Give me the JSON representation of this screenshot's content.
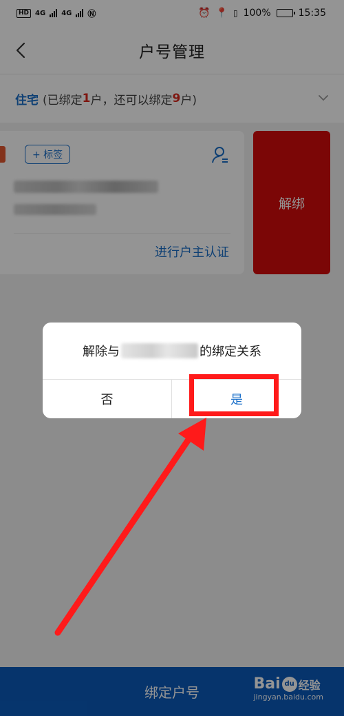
{
  "status_bar": {
    "left_badge": "HD",
    "net1": "4G",
    "net2": "4G",
    "battery_percent": "100%",
    "time": "15:35",
    "battery_level": 1.0
  },
  "header": {
    "title": "户号管理"
  },
  "residence": {
    "type": "住宅",
    "prefix": "(已绑定",
    "bound_count": "1",
    "middle": "户，还可以绑定",
    "remaining_count": "9",
    "suffix": "户)"
  },
  "card": {
    "tag_label": "+ 标签",
    "verify_link": "进行户主认证",
    "unbind_label": "解绑"
  },
  "bottom": {
    "bind_label": "绑定户号"
  },
  "watermark": {
    "logo": "Bai",
    "logo_tail": "经验",
    "paw": "du",
    "url": "jingyan.baidu.com"
  },
  "dialog": {
    "msg_prefix": "解除与",
    "msg_suffix": "的绑定关系",
    "no_label": "否",
    "yes_label": "是"
  },
  "colors": {
    "accent": "#1a6fc9",
    "unbind": "#d50b0b",
    "bottom_bar": "#0b5bbb",
    "annotation": "#ff1a1a"
  }
}
